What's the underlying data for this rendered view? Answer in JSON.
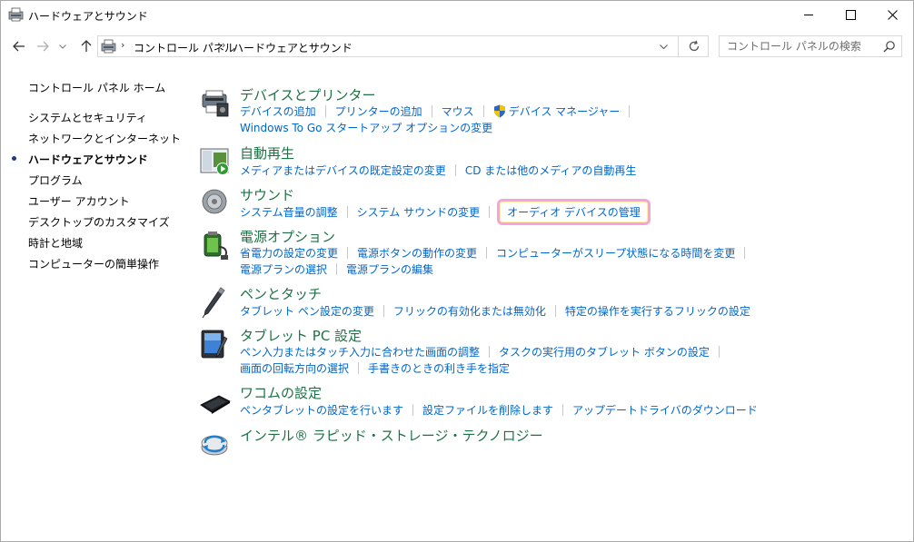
{
  "window": {
    "title": "ハードウェアとサウンド"
  },
  "nav": {
    "breadcrumb": [
      "コントロール パネル",
      "ハードウェアとサウンド"
    ],
    "search_placeholder": "コントロール パネルの検索"
  },
  "sidebar": {
    "home": "コントロール パネル ホーム",
    "items": [
      {
        "label": "システムとセキュリティ",
        "active": false
      },
      {
        "label": "ネットワークとインターネット",
        "active": false
      },
      {
        "label": "ハードウェアとサウンド",
        "active": true
      },
      {
        "label": "プログラム",
        "active": false
      },
      {
        "label": "ユーザー アカウント",
        "active": false
      },
      {
        "label": "デスクトップのカスタマイズ",
        "active": false
      },
      {
        "label": "時計と地域",
        "active": false
      },
      {
        "label": "コンピューターの簡単操作",
        "active": false
      }
    ]
  },
  "categories": {
    "devices": {
      "title": "デバイスとプリンター",
      "links": [
        "デバイスの追加",
        "プリンターの追加",
        "マウス",
        "デバイス マネージャー",
        "Windows To Go スタートアップ オプションの変更"
      ]
    },
    "autoplay": {
      "title": "自動再生",
      "links": [
        "メディアまたはデバイスの既定設定の変更",
        "CD または他のメディアの自動再生"
      ]
    },
    "sound": {
      "title": "サウンド",
      "links": [
        "システム音量の調整",
        "システム サウンドの変更",
        "オーディオ デバイスの管理"
      ]
    },
    "power": {
      "title": "電源オプション",
      "links": [
        "省電力の設定の変更",
        "電源ボタンの動作の変更",
        "コンピューターがスリープ状態になる時間を変更",
        "電源プランの選択",
        "電源プランの編集"
      ]
    },
    "pen": {
      "title": "ペンとタッチ",
      "links": [
        "タブレット ペン設定の変更",
        "フリックの有効化または無効化",
        "特定の操作を実行するフリックの設定"
      ]
    },
    "tablet": {
      "title": "タブレット PC 設定",
      "links": [
        "ペン入力またはタッチ入力に合わせた画面の調整",
        "タスクの実行用のタブレット ボタンの設定",
        "画面の回転方向の選択",
        "手書きのときの利き手を指定"
      ]
    },
    "wacom": {
      "title": "ワコムの設定",
      "links": [
        "ペンタブレットの設定を行います",
        "設定ファイルを削除します",
        "アップデートドライバのダウンロード"
      ]
    },
    "intel": {
      "title": "インテル® ラピッド・ストレージ・テクノロジー"
    }
  },
  "colors": {
    "category_title": "#1e7145",
    "link": "#0066cc",
    "highlight_border": "#f7a3d9"
  }
}
